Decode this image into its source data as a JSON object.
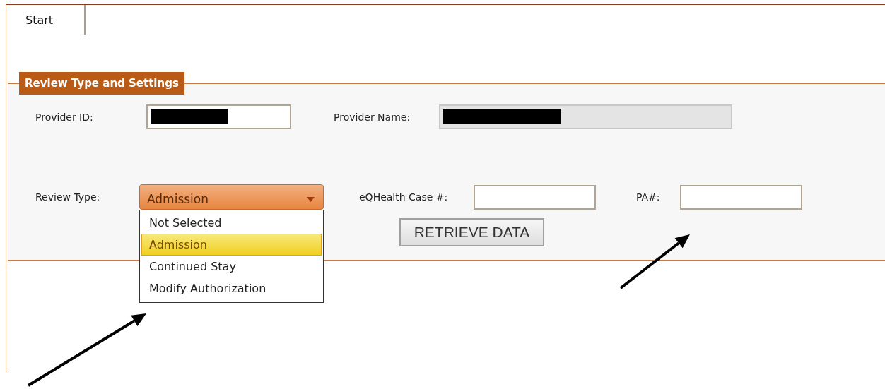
{
  "tabs": [
    {
      "label": "Start",
      "selected": true
    }
  ],
  "group": {
    "title": "Review Type and Settings"
  },
  "provider_id": {
    "label": "Provider ID:",
    "redacted": true
  },
  "provider_name": {
    "label": "Provider Name:",
    "redacted": true,
    "disabled": true
  },
  "review_type": {
    "label": "Review Type:",
    "value": "Admission",
    "expanded": true,
    "options": [
      {
        "label": "Not Selected",
        "selected": false
      },
      {
        "label": "Admission",
        "selected": true
      },
      {
        "label": "Continued Stay",
        "selected": false
      },
      {
        "label": "Modify Authorization",
        "selected": false
      }
    ]
  },
  "case_number": {
    "label": "eQHealth Case #:"
  },
  "pa_number": {
    "label": "PA#:"
  },
  "retrieve_button": {
    "label": "RETRIEVE DATA"
  }
}
